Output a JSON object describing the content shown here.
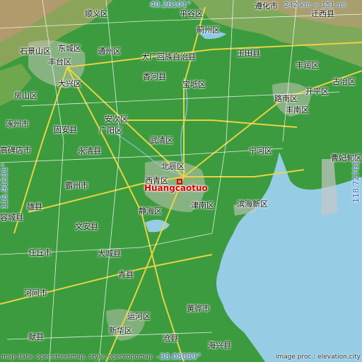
{
  "map": {
    "place_name": "Huangcaotuo",
    "coords": {
      "top": "40.26101°",
      "bottom": "-38.08089°",
      "left": "115.91531°",
      "right": "118.72761°"
    },
    "scale": "242 km = 151 mi",
    "attribution_left": "map data: openstreetmap, style: opentopomap",
    "attribution_right": "image proc.: elevation.city",
    "labels": [
      {
        "id": "shunyi",
        "text": "顺义区"
      },
      {
        "id": "pinggu",
        "text": "平谷区"
      },
      {
        "id": "zunhua",
        "text": "遵化市"
      },
      {
        "id": "qianxi",
        "text": "迁西县"
      },
      {
        "id": "jizhou",
        "text": "蓟州区"
      },
      {
        "id": "shijingshan",
        "text": "石景山区"
      },
      {
        "id": "dongcheng",
        "text": "东城区"
      },
      {
        "id": "tongzhou",
        "text": "通州区"
      },
      {
        "id": "dachang",
        "text": "大厂回族自治县"
      },
      {
        "id": "yutian",
        "text": "玉田县"
      },
      {
        "id": "fengtai",
        "text": "丰台区"
      },
      {
        "id": "fengrun",
        "text": "丰润区"
      },
      {
        "id": "guye",
        "text": "古冶区"
      },
      {
        "id": "xianghe",
        "text": "香河县"
      },
      {
        "id": "baodi",
        "text": "宝坻区"
      },
      {
        "id": "daxing",
        "text": "大兴区"
      },
      {
        "id": "fangshan",
        "text": "房山区"
      },
      {
        "id": "lunan",
        "text": "路南区"
      },
      {
        "id": "kaiping",
        "text": "开平区"
      },
      {
        "id": "fengnan",
        "text": "丰南区"
      },
      {
        "id": "zhuozhou",
        "text": "涿州市"
      },
      {
        "id": "anci",
        "text": "安次区"
      },
      {
        "id": "guan",
        "text": "固安县"
      },
      {
        "id": "guangyang",
        "text": "广阳区"
      },
      {
        "id": "wuqing",
        "text": "武清区"
      },
      {
        "id": "ninghe",
        "text": "宁河区"
      },
      {
        "id": "caofeidian",
        "text": "曹妃甸区"
      },
      {
        "id": "gaobeidian",
        "text": "高碑店市"
      },
      {
        "id": "yongqing",
        "text": "永清县"
      },
      {
        "id": "beichen",
        "text": "北辰区"
      },
      {
        "id": "xiqing",
        "text": "西青区"
      },
      {
        "id": "bazhou",
        "text": "霸州市"
      },
      {
        "id": "jinnan",
        "text": "津南区"
      },
      {
        "id": "binhai",
        "text": "滨海新区"
      },
      {
        "id": "xiong",
        "text": "雄县"
      },
      {
        "id": "jinghai",
        "text": "静海区"
      },
      {
        "id": "rongcheng",
        "text": "容城县"
      },
      {
        "id": "wenan",
        "text": "文安县"
      },
      {
        "id": "renqiu",
        "text": "任丘市"
      },
      {
        "id": "dacheng",
        "text": "大城县"
      },
      {
        "id": "qing",
        "text": "青县"
      },
      {
        "id": "hejian",
        "text": "河间市"
      },
      {
        "id": "huanghua",
        "text": "黄骅市"
      },
      {
        "id": "yunhe",
        "text": "运河区"
      },
      {
        "id": "xianxian",
        "text": "献县"
      },
      {
        "id": "xinhua",
        "text": "新华区"
      },
      {
        "id": "cang",
        "text": "沧县"
      },
      {
        "id": "haixing",
        "text": "海兴县"
      }
    ]
  }
}
